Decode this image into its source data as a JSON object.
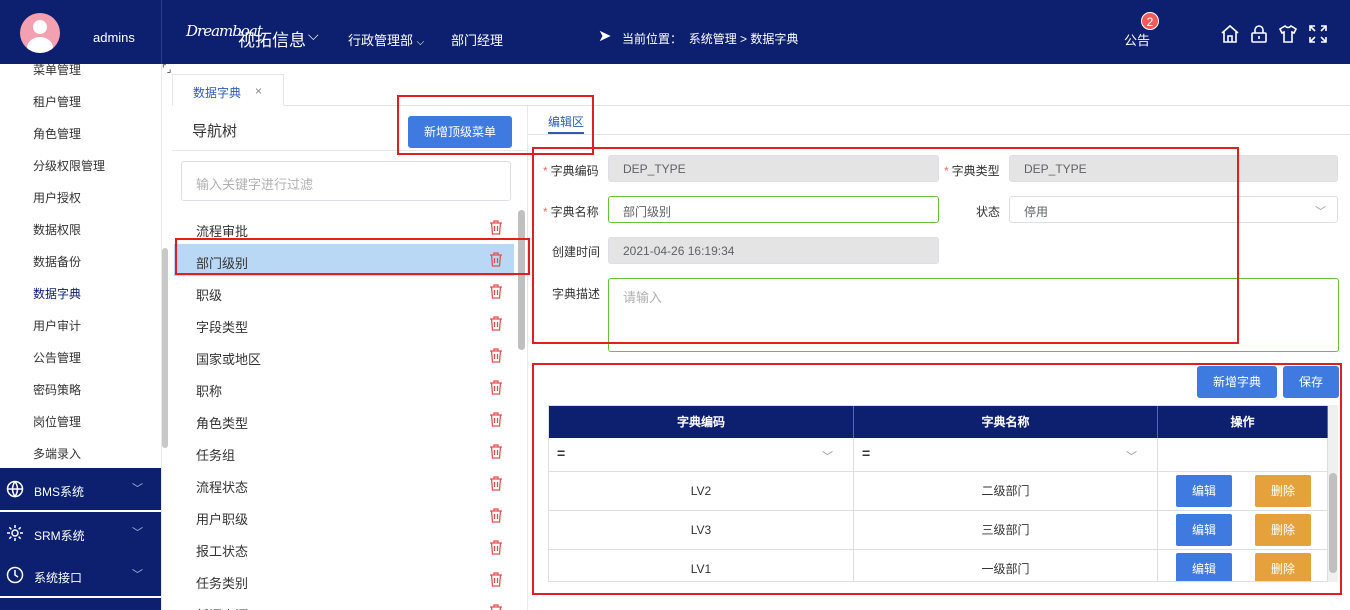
{
  "header": {
    "username": "admins",
    "logo_text": "Dreamboat",
    "brand": "视拓信息",
    "nav": [
      "行政管理部",
      "部门经理"
    ],
    "breadcrumb_prefix": "当前位置：",
    "breadcrumb": "系统管理 > 数据字典",
    "notice_label": "公告",
    "notice_count": "2"
  },
  "sidebar": {
    "items": [
      "菜单管理",
      "租户管理",
      "角色管理",
      "分级权限管理",
      "用户授权",
      "数据权限",
      "数据备份",
      "数据字典",
      "用户审计",
      "公告管理",
      "密码策略",
      "岗位管理",
      "多端录入"
    ],
    "groups": [
      {
        "label": "BMS系统",
        "icon": "globe-icon"
      },
      {
        "label": "SRM系统",
        "icon": "gear-icon"
      },
      {
        "label": "系统接口",
        "icon": "clock-icon"
      }
    ]
  },
  "tabs": [
    {
      "label": "数据字典",
      "close": "×"
    }
  ],
  "tree": {
    "title": "导航树",
    "add_button": "新增顶级菜单",
    "filter_placeholder": "输入关键字进行过滤",
    "items": [
      "流程审批",
      "部门级别",
      "职级",
      "字段类型",
      "国家或地区",
      "职称",
      "角色类型",
      "任务组",
      "流程状态",
      "用户职级",
      "报工状态",
      "任务类别",
      "新闻来源"
    ],
    "selected_index": 1
  },
  "edit": {
    "tab_label": "编辑区",
    "fields": {
      "code_label": "字典编码",
      "code_value": "DEP_TYPE",
      "type_label": "字典类型",
      "type_value": "DEP_TYPE",
      "name_label": "字典名称",
      "name_value": "部门级别",
      "status_label": "状态",
      "status_value": "停用",
      "created_label": "创建时间",
      "created_value": "2021-04-26 16:19:34",
      "desc_label": "字典描述",
      "desc_placeholder": "请输入"
    },
    "required_mark": "*"
  },
  "dict": {
    "add_button": "新增字典",
    "save_button": "保存",
    "columns": [
      "字典编码",
      "字典名称",
      "操作"
    ],
    "filter_op": "=",
    "rows": [
      {
        "code": "LV2",
        "name": "二级部门"
      },
      {
        "code": "LV3",
        "name": "三级部门"
      },
      {
        "code": "LV1",
        "name": "一级部门"
      }
    ],
    "edit_label": "编辑",
    "delete_label": "删除"
  },
  "colors": {
    "header_bg": "#0d2070",
    "primary": "#3f7ae0",
    "danger": "#e5a23c",
    "selected": "#b8d8f5",
    "annotation": "#e02020"
  }
}
